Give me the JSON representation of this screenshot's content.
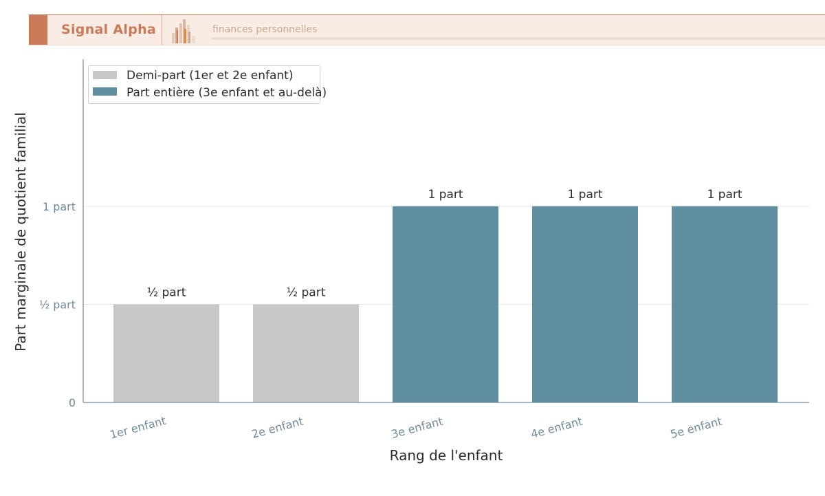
{
  "banner": {
    "brand": "Signal Alpha",
    "subtitle": "finances personnelles",
    "accent_color": "#c97a58"
  },
  "chart_data": {
    "type": "bar",
    "title": "",
    "xlabel": "Rang de l'enfant",
    "ylabel": "Part marginale de quotient familial",
    "categories": [
      "1er enfant",
      "2e enfant",
      "3e enfant",
      "4e enfant",
      "5e enfant"
    ],
    "values": [
      0.5,
      0.5,
      1,
      1,
      1
    ],
    "data_labels": [
      "½ part",
      "½ part",
      "1 part",
      "1 part",
      "1 part"
    ],
    "bar_series": [
      0,
      0,
      1,
      1,
      1
    ],
    "series": [
      {
        "name": "Demi-part (1er et 2e enfant)",
        "color": "#c8c8c8"
      },
      {
        "name": "Part entière (3e enfant et au-delà)",
        "color": "#5f8ea0"
      }
    ],
    "yticks": [
      {
        "value": 0,
        "label": "0"
      },
      {
        "value": 0.5,
        "label": "½ part"
      },
      {
        "value": 1,
        "label": "1 part"
      }
    ],
    "ylim": [
      0,
      1.75
    ],
    "grid": true,
    "legend_position": "top-left"
  }
}
